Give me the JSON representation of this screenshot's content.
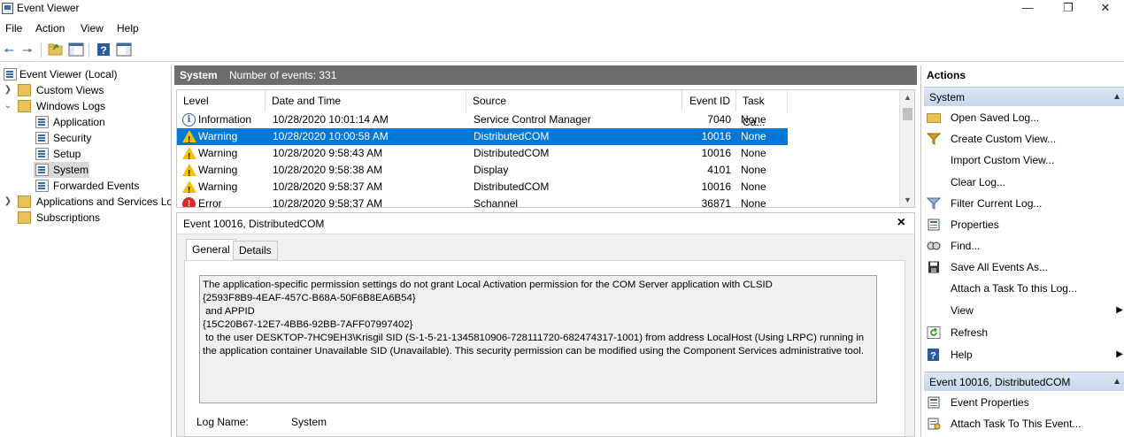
{
  "window": {
    "title": "Event Viewer",
    "controls": [
      "—",
      "❐",
      "✕"
    ]
  },
  "menu": [
    "File",
    "Action",
    "View",
    "Help"
  ],
  "tree": {
    "root": "Event Viewer (Local)",
    "custom_views": "Custom Views",
    "windows_logs": "Windows Logs",
    "application": "Application",
    "security": "Security",
    "setup": "Setup",
    "system": "System",
    "forwarded": "Forwarded Events",
    "apps_services": "Applications and Services Lo",
    "subscriptions": "Subscriptions"
  },
  "center": {
    "title": "System",
    "count_text": "Number of events: 331"
  },
  "events": {
    "columns": [
      "Level",
      "Date and Time",
      "Source",
      "Event ID",
      "Task Ca..."
    ],
    "rows": [
      {
        "level": "Information",
        "icon": "info-icon",
        "datetime": "10/28/2020 10:01:14 AM",
        "source": "Service Control Manager",
        "event_id": "7040",
        "task": "None"
      },
      {
        "level": "Warning",
        "icon": "warning-icon",
        "datetime": "10/28/2020 10:00:58 AM",
        "source": "DistributedCOM",
        "event_id": "10016",
        "task": "None"
      },
      {
        "level": "Warning",
        "icon": "warning-icon",
        "datetime": "10/28/2020 9:58:43 AM",
        "source": "DistributedCOM",
        "event_id": "10016",
        "task": "None"
      },
      {
        "level": "Warning",
        "icon": "warning-icon",
        "datetime": "10/28/2020 9:58:38 AM",
        "source": "Display",
        "event_id": "4101",
        "task": "None"
      },
      {
        "level": "Warning",
        "icon": "warning-icon",
        "datetime": "10/28/2020 9:58:37 AM",
        "source": "DistributedCOM",
        "event_id": "10016",
        "task": "None"
      },
      {
        "level": "Error",
        "icon": "error-icon",
        "datetime": "10/28/2020 9:58:37 AM",
        "source": "Schannel",
        "event_id": "36871",
        "task": "None"
      }
    ]
  },
  "detail": {
    "title": "Event 10016, DistributedCOM",
    "close": "×",
    "tabs": [
      "General",
      "Details"
    ],
    "description": "The application-specific permission settings do not grant Local Activation permission for the COM Server application with CLSID\n{2593F8B9-4EAF-457C-B68A-50F6B8EA6B54}\n and APPID\n{15C20B67-12E7-4BB6-92BB-7AFF07997402}\n to the user DESKTOP-7HC9EH3\\Krisgil SID (S-1-5-21-1345810906-728111720-682474317-1001) from address LocalHost (Using LRPC) running in the application container Unavailable SID (Unavailable). This security permission can be modified using the Component Services administrative tool.",
    "log_name_label": "Log Name:",
    "log_name_value": "System"
  },
  "actions": {
    "title": "Actions",
    "section1": "System",
    "items1": [
      {
        "label": "Open Saved Log...",
        "icon": "folder-open-icon"
      },
      {
        "label": "Create Custom View...",
        "icon": "filter-icon"
      },
      {
        "label": "Import Custom View...",
        "icon": ""
      },
      {
        "label": "Clear Log...",
        "icon": ""
      },
      {
        "label": "Filter Current Log...",
        "icon": "filter-icon"
      },
      {
        "label": "Properties",
        "icon": "properties-icon"
      },
      {
        "label": "Find...",
        "icon": "find-icon"
      },
      {
        "label": "Save All Events As...",
        "icon": "save-icon"
      },
      {
        "label": "Attach a Task To this Log...",
        "icon": ""
      },
      {
        "label": "View",
        "icon": ""
      },
      {
        "label": "Refresh",
        "icon": "refresh-icon"
      },
      {
        "label": "Help",
        "icon": "help-icon"
      }
    ],
    "section2": "Event 10016, DistributedCOM",
    "items2": [
      {
        "label": "Event Properties",
        "icon": "event-properties-icon"
      },
      {
        "label": "Attach Task To This Event...",
        "icon": "attach-task-icon"
      }
    ]
  }
}
